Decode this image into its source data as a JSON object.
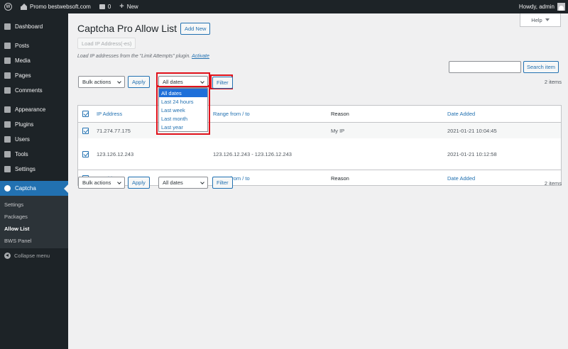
{
  "adminbar": {
    "site_name": "Promo bestwebsoft.com",
    "comments_count": "0",
    "new_label": "New",
    "greeting": "Howdy, admin"
  },
  "sidebar": {
    "items": [
      {
        "label": "Dashboard",
        "icon": "dashboard-icon"
      },
      {
        "label": "Posts",
        "icon": "pin-icon"
      },
      {
        "label": "Media",
        "icon": "media-icon"
      },
      {
        "label": "Pages",
        "icon": "page-icon"
      },
      {
        "label": "Comments",
        "icon": "comment-icon"
      },
      {
        "label": "Appearance",
        "icon": "brush-icon"
      },
      {
        "label": "Plugins",
        "icon": "plugin-icon"
      },
      {
        "label": "Users",
        "icon": "users-icon"
      },
      {
        "label": "Tools",
        "icon": "wrench-icon"
      },
      {
        "label": "Settings",
        "icon": "settings-icon"
      },
      {
        "label": "Captcha",
        "icon": "captcha-icon"
      }
    ],
    "submenu": [
      "Settings",
      "Packages",
      "Allow List",
      "BWS Panel"
    ],
    "collapse_label": "Collapse menu"
  },
  "page": {
    "help_label": "Help",
    "title": "Captcha Pro Allow List",
    "add_new": "Add New",
    "load_button": "Load IP Address(-es)",
    "load_note": "Load IP addresses from the \"Limit Attempts\" plugin.",
    "activate_link": "Activate",
    "search_button": "Search item",
    "search_value": ""
  },
  "toolbar": {
    "bulk_actions": "Bulk actions",
    "apply": "Apply",
    "dates": "All dates",
    "filter": "Filter",
    "count": "2 items"
  },
  "date_options": [
    "All dates",
    "Last 24 hours",
    "Last week",
    "Last month",
    "Last year"
  ],
  "table": {
    "columns": [
      "IP Address",
      "Range from / to",
      "Reason",
      "Date Added"
    ],
    "rows": [
      {
        "ip": "71.274.77.175",
        "range": "",
        "reason": "My IP",
        "date": "2021-01-21 10:04:45"
      },
      {
        "ip": "123.126.12.243",
        "range": "123.126.12.243 - 123.126.12.243",
        "reason": "",
        "date": "2021-01-21 10:12:58"
      }
    ]
  },
  "colors": {
    "accent": "#2271b1",
    "highlight": "#e0111b",
    "sidebar": "#1d2327"
  }
}
